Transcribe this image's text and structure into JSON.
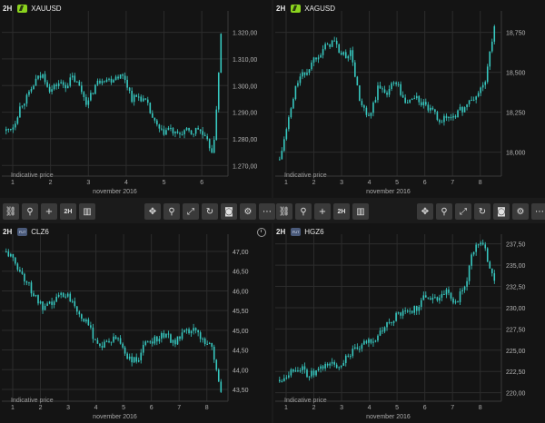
{
  "toolbar": {
    "link_icon": "link-icon",
    "zoom_icon": "magnifier-icon",
    "crosshair_icon": "plus-icon",
    "timeframe_label": "2H",
    "candles_icon": "candles-icon",
    "move_icon": "move-icon",
    "fullscreen_icon": "fullscreen-icon",
    "refresh_icon": "refresh-icon",
    "camera_icon": "camera-icon",
    "settings_icon": "gear-icon",
    "more_icon": "more-icon"
  },
  "charts": [
    {
      "symbol": "XAUUSD",
      "timeframe": "2H",
      "icon": "gold-spot-icon",
      "indicative": "Indicative price",
      "x_labels": [
        "1",
        "2",
        "3",
        "4",
        "5",
        "6"
      ],
      "month_label": "november 2016",
      "y_ticks": [
        "1.320,00",
        "1.310,00",
        "1.300,00",
        "1.290,00",
        "1.280,00",
        "1.270,00"
      ],
      "ylim": [
        1266,
        1326
      ]
    },
    {
      "symbol": "XAGUSD",
      "timeframe": "2H",
      "icon": "silver-spot-icon",
      "indicative": "Indicative price",
      "x_labels": [
        "1",
        "2",
        "3",
        "4",
        "5",
        "6",
        "7",
        "8"
      ],
      "month_label": "november 2016",
      "y_ticks": [
        "18,750",
        "18,500",
        "18,250",
        "18,000"
      ],
      "ylim": [
        17.85,
        18.85
      ]
    },
    {
      "symbol": "CLZ6",
      "timeframe": "2H",
      "icon": "futures-icon",
      "indicative": "Indicative price",
      "x_labels": [
        "1",
        "2",
        "3",
        "4",
        "5",
        "6",
        "7",
        "8"
      ],
      "month_label": "november 2016",
      "y_ticks": [
        "47,00",
        "46,50",
        "46,00",
        "45,50",
        "45,00",
        "44,50",
        "44,00",
        "43,50"
      ],
      "ylim": [
        43.2,
        47.3
      ]
    },
    {
      "symbol": "HGZ6",
      "timeframe": "2H",
      "icon": "futures-icon",
      "indicative": "Indicative price",
      "x_labels": [
        "1",
        "2",
        "3",
        "4",
        "5",
        "6",
        "7",
        "8"
      ],
      "month_label": "november 2016",
      "y_ticks": [
        "237,50",
        "235,00",
        "232,50",
        "230,00",
        "227,50",
        "225,00",
        "222,50",
        "220,00"
      ],
      "ylim": [
        219,
        238
      ]
    }
  ],
  "chart_data": [
    {
      "type": "candlestick",
      "title": "XAUUSD",
      "x": [
        "1",
        "2",
        "3",
        "4",
        "5",
        "6"
      ],
      "close": [
        1283,
        1285,
        1293,
        1296,
        1302,
        1304,
        1298,
        1301,
        1300,
        1303,
        1299,
        1293,
        1300,
        1303,
        1302,
        1304,
        1303,
        1295,
        1296,
        1293,
        1286,
        1282,
        1284,
        1281,
        1283,
        1282,
        1284,
        1279,
        1275,
        1319
      ]
    },
    {
      "type": "candlestick",
      "title": "XAGUSD",
      "x": [
        "1",
        "2",
        "3",
        "4",
        "5",
        "6",
        "7",
        "8"
      ],
      "close": [
        17.95,
        18.2,
        18.45,
        18.5,
        18.6,
        18.65,
        18.7,
        18.6,
        18.62,
        18.3,
        18.2,
        18.4,
        18.38,
        18.45,
        18.3,
        18.35,
        18.3,
        18.25,
        18.2,
        18.22,
        18.25,
        18.3,
        18.35,
        18.45,
        18.78
      ]
    },
    {
      "type": "candlestick",
      "title": "CLZ6",
      "x": [
        "1",
        "2",
        "3",
        "4",
        "5",
        "6",
        "7",
        "8"
      ],
      "close": [
        47.0,
        46.7,
        46.3,
        45.9,
        45.5,
        45.7,
        45.95,
        45.8,
        45.4,
        45.0,
        44.6,
        44.7,
        44.8,
        44.3,
        44.2,
        44.7,
        44.8,
        44.9,
        44.7,
        44.9,
        45.0,
        44.8,
        44.6,
        43.4
      ]
    },
    {
      "type": "candlestick",
      "title": "HGZ6",
      "x": [
        "1",
        "2",
        "3",
        "4",
        "5",
        "6",
        "7",
        "8"
      ],
      "close": [
        221.5,
        222.5,
        223.0,
        222.0,
        222.5,
        223.5,
        223.0,
        224.5,
        225.0,
        226.0,
        226.5,
        228.0,
        229.0,
        229.5,
        230.0,
        231.5,
        231.0,
        232.0,
        230.5,
        232.5,
        237.5,
        237.0,
        233.0
      ]
    }
  ]
}
